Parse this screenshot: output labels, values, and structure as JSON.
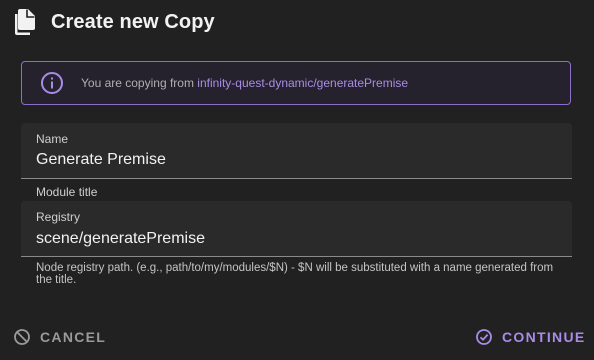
{
  "dialog": {
    "title": "Create new Copy",
    "title_icon": "file-copy-icon"
  },
  "alert": {
    "icon": "info-icon",
    "prefix": "You are copying from ",
    "source_link": "infinity-quest-dynamic/generatePremise",
    "border_color": "#8c6fc8",
    "accent_color": "#a98be8"
  },
  "form": {
    "name": {
      "label": "Name",
      "value": "Generate Premise"
    },
    "module_title_label": "Module title",
    "registry": {
      "label": "Registry",
      "value": "scene/generatePremise",
      "helper": "Node registry path. (e.g., path/to/my/modules/$N) - $N will be substituted with a name generated from the title."
    }
  },
  "actions": {
    "cancel_label": "CANCEL",
    "cancel_icon": "block-icon",
    "continue_label": "CONTINUE",
    "continue_icon": "check-circle-icon"
  }
}
